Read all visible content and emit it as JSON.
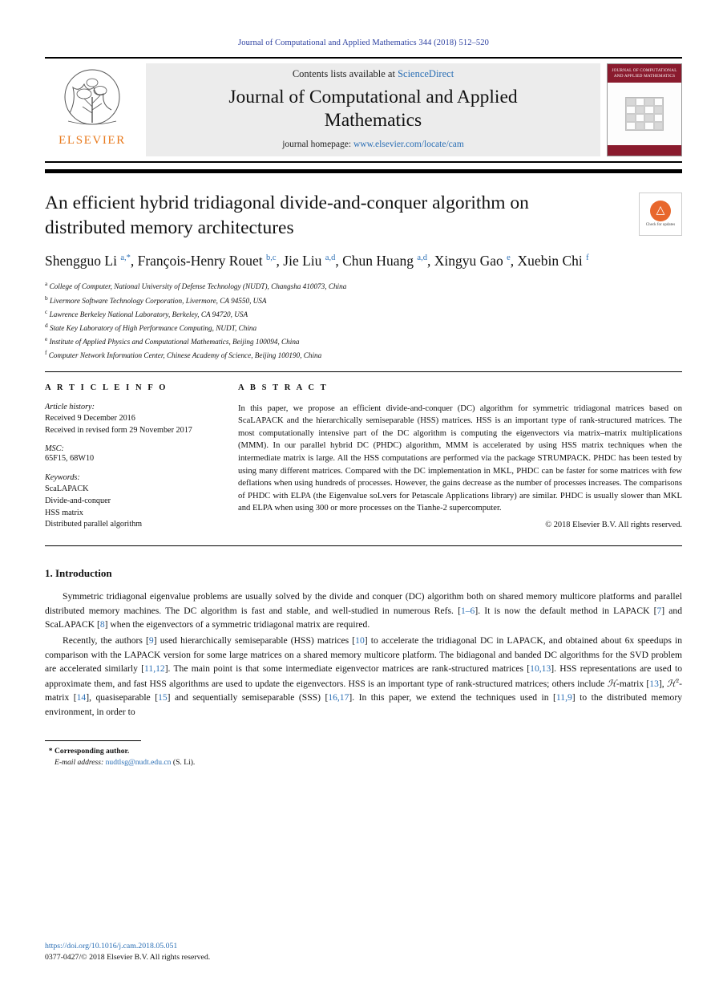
{
  "journal_ref": "Journal of Computational and Applied Mathematics 344 (2018) 512–520",
  "masthead": {
    "contents_prefix": "Contents lists available at ",
    "sciencedirect": "ScienceDirect",
    "journal_title_line1": "Journal of Computational and Applied",
    "journal_title_line2": "Mathematics",
    "homepage_prefix": "journal homepage: ",
    "homepage_url": "www.elsevier.com/locate/cam",
    "publisher_wordmark": "ELSEVIER",
    "cover_title": "JOURNAL OF COMPUTATIONAL AND APPLIED MATHEMATICS"
  },
  "article": {
    "title": "An efficient hybrid tridiagonal divide-and-conquer algorithm on distributed memory architectures",
    "crossmark_label": "Check for updates",
    "authors_html": "Shengguo Li <sup>a,*</sup>, François-Henry Rouet <sup>b,c</sup>, Jie Liu <sup>a,d</sup>, Chun Huang <sup>a,d</sup>, Xingyu Gao <sup>e</sup>, Xuebin Chi <sup>f</sup>",
    "affiliations": [
      {
        "mark": "a",
        "text": "College of Computer, National University of Defense Technology (NUDT), Changsha 410073, China"
      },
      {
        "mark": "b",
        "text": "Livermore Software Technology Corporation, Livermore, CA 94550, USA"
      },
      {
        "mark": "c",
        "text": "Lawrence Berkeley National Laboratory, Berkeley, CA 94720, USA"
      },
      {
        "mark": "d",
        "text": "State Key Laboratory of High Performance Computing, NUDT, China"
      },
      {
        "mark": "e",
        "text": "Institute of Applied Physics and Computational Mathematics, Beijing 100094, China"
      },
      {
        "mark": "f",
        "text": "Computer Network Information Center, Chinese Academy of Science, Beijing 100190, China"
      }
    ]
  },
  "article_info": {
    "heading": "A R T I C L E   I N F O",
    "history_label": "Article history:",
    "history_lines": [
      "Received 9 December 2016",
      "Received in revised form 29 November 2017"
    ],
    "msc_label": "MSC:",
    "msc_value": "65F15, 68W10",
    "keywords_label": "Keywords:",
    "keywords": [
      "ScaLAPACK",
      "Divide-and-conquer",
      "HSS matrix",
      "Distributed parallel algorithm"
    ]
  },
  "abstract": {
    "heading": "A B S T R A C T",
    "text": "In this paper, we propose an efficient divide-and-conquer (DC) algorithm for symmetric tridiagonal matrices based on ScaLAPACK and the hierarchically semiseparable (HSS) matrices. HSS is an important type of rank-structured matrices. The most computationally intensive part of the DC algorithm is computing the eigenvectors via matrix–matrix multiplications (MMM). In our parallel hybrid DC (PHDC) algorithm, MMM is accelerated by using HSS matrix techniques when the intermediate matrix is large. All the HSS computations are performed via the package STRUMPACK. PHDC has been tested by using many different matrices. Compared with the DC implementation in MKL, PHDC can be faster for some matrices with few deflations when using hundreds of processes. However, the gains decrease as the number of processes increases. The comparisons of PHDC with ELPA (the Eigenvalue soLvers for Petascale Applications library) are similar. PHDC is usually slower than MKL and ELPA when using 300 or more processes on the Tianhe-2 supercomputer.",
    "copyright": "© 2018 Elsevier B.V. All rights reserved."
  },
  "section": {
    "number_title": "1.  Introduction",
    "paragraph1": "Symmetric tridiagonal eigenvalue problems are usually solved by the divide and conquer (DC) algorithm both on shared memory multicore platforms and parallel distributed memory machines. The DC algorithm is fast and stable, and well-studied in numerous Refs. [1–6]. It is now the default method in LAPACK [7] and ScaLAPACK [8] when the eigenvectors of a symmetric tridiagonal matrix are required.",
    "paragraph2": "Recently, the authors [9] used hierarchically semiseparable (HSS) matrices [10] to accelerate the tridiagonal DC in LAPACK, and obtained about 6x speedups in comparison with the LAPACK version for some large matrices on a shared memory multicore platform. The bidiagonal and banded DC algorithms for the SVD problem are accelerated similarly [11,12]. The main point is that some intermediate eigenvector matrices are rank-structured matrices [10,13]. HSS representations are used to approximate them, and fast HSS algorithms are used to update the eigenvectors. HSS is an important type of rank-structured matrices; others include H-matrix [13], H²-matrix [14], quasiseparable [15] and sequentially semiseparable (SSS) [16,17]. In this paper, we extend the techniques used in [11,9] to the distributed memory environment, in order to"
  },
  "footnotes": {
    "corresponding": "*  Corresponding author.",
    "email_label": "E-mail address:",
    "email": "nudtlsg@nudt.edu.cn",
    "email_suffix": "(S. Li)."
  },
  "bottom": {
    "doi": "https://doi.org/10.1016/j.cam.2018.05.051",
    "issn_line": "0377-0427/© 2018 Elsevier B.V. All rights reserved."
  },
  "colors": {
    "link": "#2b6fb5",
    "journal_ref": "#2b3fa0",
    "elsevier_orange": "#e87a1e",
    "cover_red": "#8a1b2e"
  }
}
